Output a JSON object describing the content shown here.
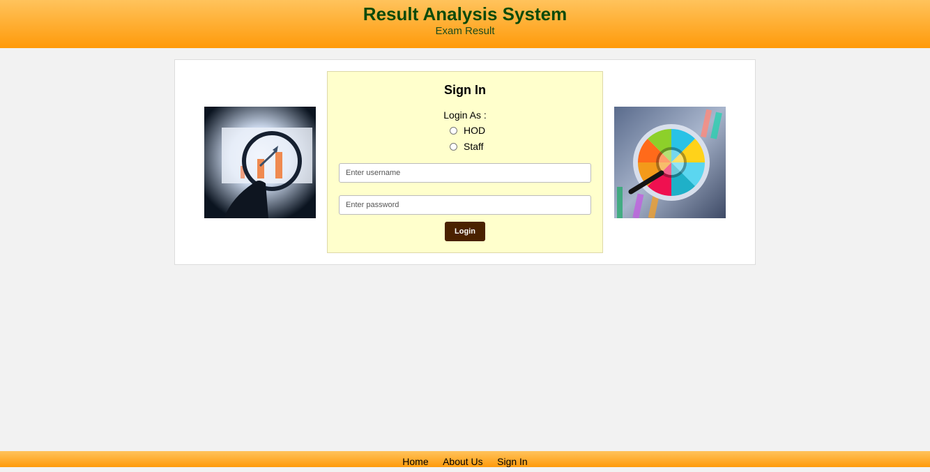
{
  "header": {
    "title": "Result Analysis System",
    "subtitle": "Exam Result"
  },
  "signin": {
    "title": "Sign In",
    "login_as_label": "Login As :",
    "roles": [
      "HOD",
      "Staff"
    ],
    "username_placeholder": "Enter username",
    "password_placeholder": "Enter password",
    "login_button": "Login"
  },
  "images": {
    "left": "magnifier-bar-chart-image",
    "right": "magnifier-pie-chart-image"
  },
  "footer": {
    "links": [
      "Home",
      "About Us",
      "Sign In"
    ]
  },
  "colors": {
    "header_start": "#ffc35c",
    "header_end": "#ff9a0a",
    "title": "#0b4a0b",
    "signin_bg": "#ffffcc",
    "button": "#4a2100"
  }
}
